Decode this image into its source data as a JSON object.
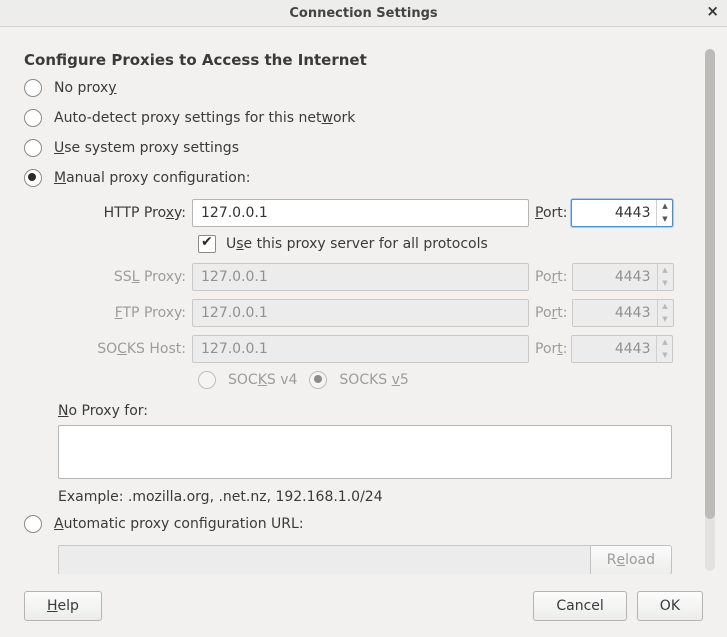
{
  "titlebar": {
    "title": "Connection Settings"
  },
  "heading": "Configure Proxies to Access the Internet",
  "mode": {
    "none": {
      "pre": "No prox",
      "key": "y",
      "post": ""
    },
    "auto": {
      "pre": "Auto-detect proxy settings for this net",
      "key": "w",
      "post": "ork"
    },
    "system": {
      "pre": "",
      "key": "U",
      "post": "se system proxy settings"
    },
    "manual": {
      "pre": "",
      "key": "M",
      "post": "anual proxy configuration:"
    },
    "pac": {
      "pre": "",
      "key": "A",
      "post": "utomatic proxy configuration URL:"
    }
  },
  "http": {
    "label_pre": "HTTP Pro",
    "label_key": "x",
    "label_post": "y:",
    "host": "127.0.0.1",
    "port_label_pre": "",
    "port_label_key": "P",
    "port_label_post": "ort:",
    "port": "4443"
  },
  "use_all": {
    "pre": "U",
    "key": "s",
    "post": "e this proxy server for all protocols"
  },
  "ssl": {
    "label_pre": "SS",
    "label_key": "L",
    "label_post": " Proxy:",
    "host": "127.0.0.1",
    "port_label_pre": "Po",
    "port_label_key": "r",
    "port_label_post": "t:",
    "port": "4443"
  },
  "ftp": {
    "label_pre": "",
    "label_key": "F",
    "label_post": "TP Proxy:",
    "host": "127.0.0.1",
    "port_label_pre": "Po",
    "port_label_key": "r",
    "port_label_post": "t:",
    "port": "4443"
  },
  "socks": {
    "label_pre": "SO",
    "label_key": "C",
    "label_post": "KS Host:",
    "host": "127.0.0.1",
    "port_label_pre": "Por",
    "port_label_key": "t",
    "port_label_post": ":",
    "port": "4443"
  },
  "socks_ver": {
    "v4": {
      "pre": "SOC",
      "key": "K",
      "post": "S v4"
    },
    "v5": {
      "pre": "SOCKS ",
      "key": "v",
      "post": "5"
    }
  },
  "noproxy": {
    "label_pre": "",
    "label_key": "N",
    "label_post": "o Proxy for:",
    "value": ""
  },
  "example": "Example: .mozilla.org, .net.nz, 192.168.1.0/24",
  "pac": {
    "url": "",
    "reload_pre": "R",
    "reload_key": "e",
    "reload_post": "load"
  },
  "footer": {
    "help": {
      "pre": "",
      "key": "H",
      "post": "elp"
    },
    "cancel": "Cancel",
    "ok": "OK"
  }
}
